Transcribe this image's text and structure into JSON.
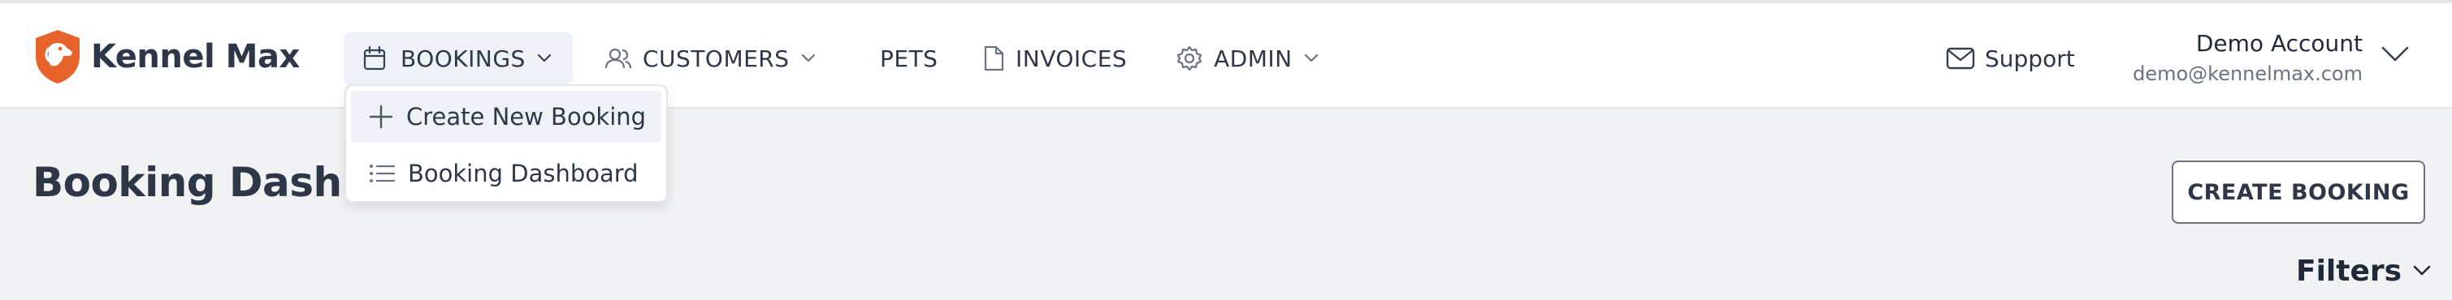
{
  "brand": {
    "name": "Kennel Max",
    "logo_icon": "dog-shield-logo",
    "accent": "#e8622c"
  },
  "nav": {
    "bookings": {
      "label": "BOOKINGS",
      "icon": "calendar-icon"
    },
    "customers": {
      "label": "CUSTOMERS",
      "icon": "users-icon"
    },
    "pets": {
      "label": "PETS"
    },
    "invoices": {
      "label": "INVOICES",
      "icon": "document-icon"
    },
    "admin": {
      "label": "ADMIN",
      "icon": "gear-icon"
    }
  },
  "bookings_menu": {
    "items": [
      {
        "label": "Create New Booking",
        "icon": "plus-icon"
      },
      {
        "label": "Booking Dashboard",
        "icon": "list-icon"
      }
    ]
  },
  "support": {
    "label": "Support",
    "icon": "mail-icon"
  },
  "account": {
    "name": "Demo Account",
    "email": "demo@kennelmax.com"
  },
  "page": {
    "title": "Booking Dashboard",
    "create_button": "CREATE BOOKING",
    "filters_label": "Filters"
  }
}
